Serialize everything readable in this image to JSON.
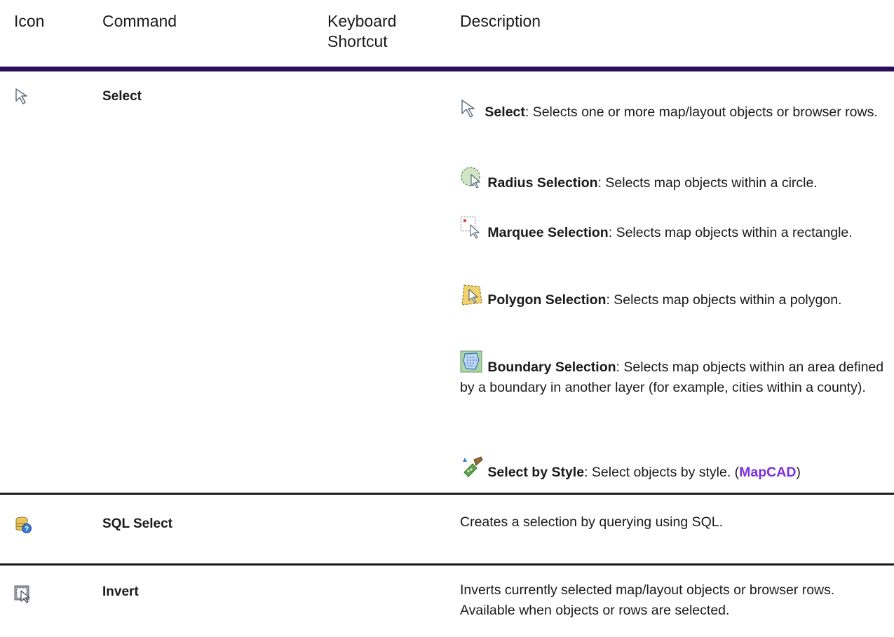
{
  "table": {
    "headers": {
      "icon": "Icon",
      "command": "Command",
      "keyboard_line1": "Keyboard",
      "keyboard_line2": "Shortcut",
      "description": "Description"
    },
    "rows": [
      {
        "icon": "select-arrow-icon",
        "command": "Select",
        "shortcut": "",
        "entries": [
          {
            "icon": "select-arrow-icon",
            "name": "Select",
            "text": ": Selects one or more map/layout objects or browser rows."
          },
          {
            "icon": "radius-selection-icon",
            "name": "Radius Selection",
            "text": ": Selects map objects within a circle."
          },
          {
            "icon": "marquee-selection-icon",
            "name": "Marquee Selection",
            "text": ": Selects map objects within a rectangle."
          },
          {
            "icon": "polygon-selection-icon",
            "name": "Polygon Selection",
            "text": ": Selects map objects within a polygon."
          },
          {
            "icon": "boundary-selection-icon",
            "name": "Boundary Selection",
            "text": ": Selects map objects within an area defined by a boundary in another layer (for example, cities within a county)."
          },
          {
            "icon": "select-by-style-icon",
            "name": "Select by Style",
            "text": ": Select objects by style. (",
            "link": "MapCAD",
            "text_after": ")"
          }
        ]
      },
      {
        "icon": "sql-select-icon",
        "command": "SQL Select",
        "shortcut": "",
        "description": "Creates a selection by querying using SQL."
      },
      {
        "icon": "invert-selection-icon",
        "command": "Invert",
        "shortcut": "",
        "description": "Inverts currently selected map/layout objects or browser rows. Available when objects or rows are selected."
      }
    ]
  },
  "colors": {
    "header_rule": "#2a0f5c",
    "row_rule": "#1a1a1a",
    "link": "#7b2fe0"
  }
}
